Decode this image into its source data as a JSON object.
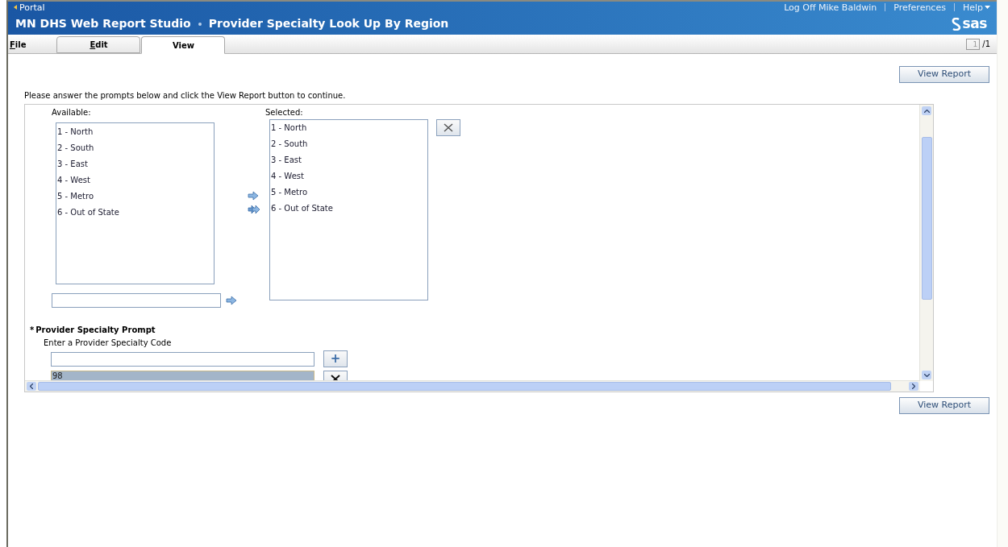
{
  "header": {
    "portal_link": "Portal",
    "app_title": "MN DHS Web Report Studio",
    "report_title": "Provider Specialty Look Up By Region",
    "links": [
      {
        "label": "Log Off Mike Baldwin",
        "menu": false
      },
      {
        "label": "Preferences",
        "menu": false
      },
      {
        "label": "Help",
        "menu": true
      }
    ],
    "logo": "sas"
  },
  "menu": [
    {
      "label": "File",
      "mnemonic": true
    }
  ],
  "tabs": [
    {
      "label": "Edit",
      "mnemonic": true,
      "selected": false
    },
    {
      "label": "View",
      "mnemonic": false,
      "selected": true
    }
  ],
  "page": {
    "current": "1",
    "total": "/1"
  },
  "view_report_buttons": [
    "View Report",
    "View Report"
  ],
  "instructions": "Please answer the prompts below and click the View Report button to continue.",
  "region_prompt": {
    "available_label": "Available:",
    "available_items": [
      "1 - North",
      "2 - South",
      "3 - East",
      "4 - West",
      "5 - Metro",
      "6 - Out of State"
    ],
    "selected_label": "Selected:",
    "selected_items": [
      "1 - North",
      "2 - South",
      "3 - East",
      "4 - West",
      "5 - Metro",
      "6 - Out of State"
    ]
  },
  "specialty_prompt": {
    "required_mark": "*",
    "title": "Provider Specialty Prompt",
    "subtitle": "Enter a Provider Specialty Code",
    "add_button": "+",
    "values": [
      "98"
    ]
  }
}
